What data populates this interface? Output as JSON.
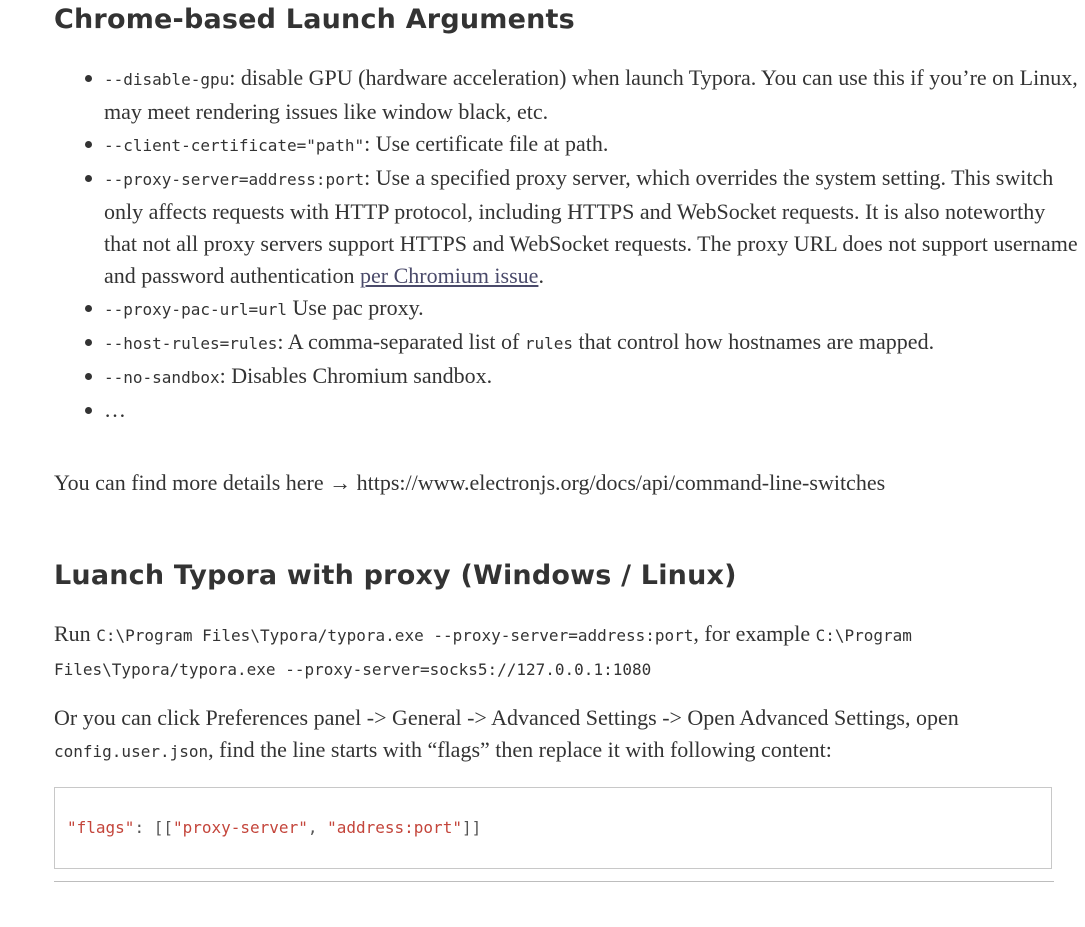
{
  "section1": {
    "heading": "Chrome-based Launch Arguments",
    "items": [
      {
        "code": "--disable-gpu",
        "text": ": disable GPU (hardware acceleration) when launch Typora. You can use this if you’re on Linux, may meet rendering issues like window black, etc."
      },
      {
        "code": "--client-certificate=\"path\"",
        "text": ": Use certificate file at path."
      },
      {
        "code": "--proxy-server=address:port",
        "text": ": Use a specified proxy server, which overrides the system setting. This switch only affects requests with HTTP protocol, including HTTPS and WebSocket requests. It is also noteworthy that not all proxy servers support HTTPS and WebSocket requests. The proxy URL does not support username and password authentication ",
        "link": "per Chromium issue",
        "after": "."
      },
      {
        "code": "--proxy-pac-url=url",
        "text": " Use pac proxy."
      },
      {
        "code": "--host-rules=rules",
        "text": ": A comma-separated list of ",
        "code2": "rules",
        "text2": " that control how hostnames are mapped."
      },
      {
        "code": "--no-sandbox",
        "text": ": Disables Chromium sandbox."
      },
      {
        "text": "…"
      }
    ],
    "more_details": "You can find more details here → https://www.electronjs.org/docs/api/command-line-switches"
  },
  "section2": {
    "heading": "Luanch Typora with proxy (Windows / Linux)",
    "run_prefix": "Run ",
    "run_code": "C:\\Program Files\\Typora/typora.exe --proxy-server=address:port",
    "run_middle": ", for example ",
    "run_example": "C:\\Program Files\\Typora/typora.exe --proxy-server=socks5://127.0.0.1:1080",
    "pref_text1": "Or you can click Preferences panel -> General -> Advanced Settings -> Open Advanced Settings, open ",
    "pref_code": "config.user.json",
    "pref_text2": ", find the line starts with “flags” then replace it with following content:",
    "code_block": {
      "key": "\"flags\"",
      "colon": ": [[",
      "value1": "\"proxy-server\"",
      "comma": ", ",
      "value2": "\"address:port\"",
      "close": "]]"
    }
  },
  "colors": {
    "text": "#333333",
    "string": "#c4453b",
    "link": "#4a4a6a",
    "border": "#c8c8c8"
  }
}
